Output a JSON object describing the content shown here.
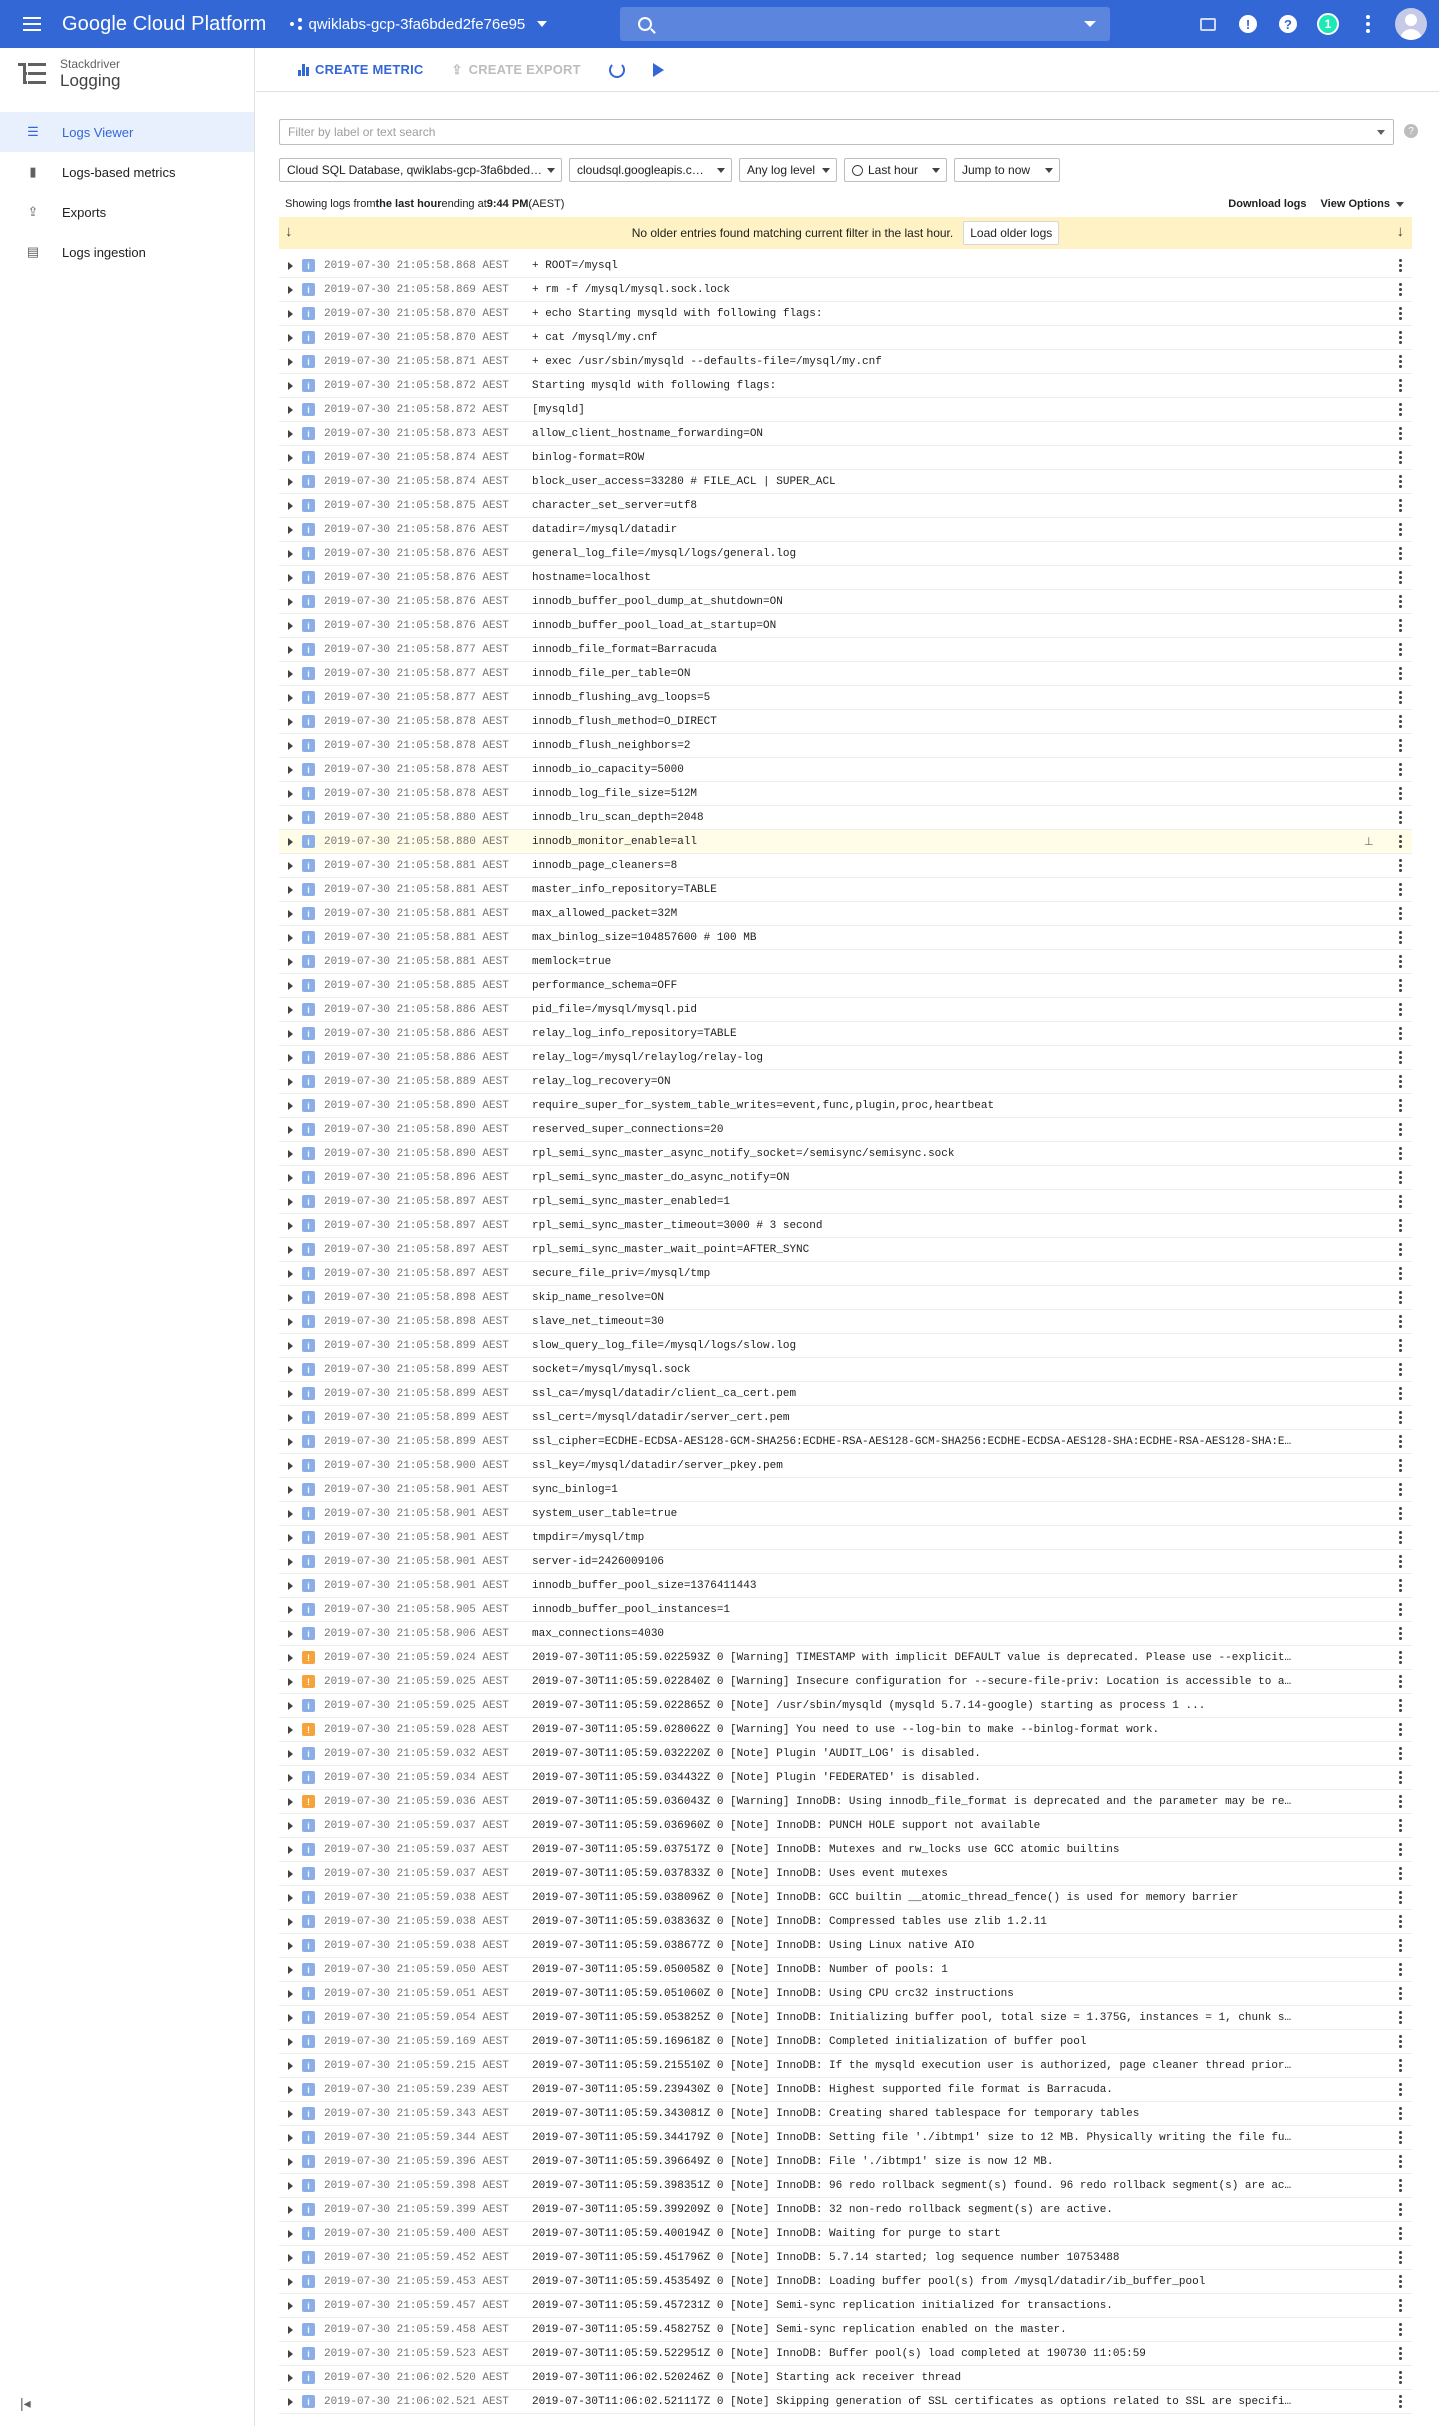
{
  "topbar": {
    "title": "Google Cloud Platform",
    "project": "qwiklabs-gcp-3fa6bded2fe76e95",
    "notification_count": "1"
  },
  "sidebar": {
    "product_sub": "Stackdriver",
    "product_name": "Logging",
    "items": [
      {
        "label": "Logs Viewer",
        "icon": "list-icon",
        "active": true
      },
      {
        "label": "Logs-based metrics",
        "icon": "bar-chart-icon",
        "active": false
      },
      {
        "label": "Exports",
        "icon": "export-icon",
        "active": false
      },
      {
        "label": "Logs ingestion",
        "icon": "ingestion-icon",
        "active": false
      }
    ]
  },
  "toolbar": {
    "create_metric": "CREATE METRIC",
    "create_export": "CREATE EXPORT"
  },
  "filter": {
    "placeholder": "Filter by label or text search"
  },
  "dropdowns": {
    "resource": "Cloud SQL Database, qwiklabs-gcp-3fa6bded…",
    "log": "cloudsql.googleapis.c…",
    "level": "Any log level",
    "time": "Last hour",
    "jump": "Jump to now"
  },
  "info": {
    "prefix": "Showing logs from ",
    "range": "the last hour",
    "middle": " ending at ",
    "end_time": "9:44 PM",
    "tz": " (AEST)",
    "download": "Download logs",
    "view_options": "View Options"
  },
  "notice": {
    "text": "No older entries found matching current filter in the last hour.",
    "button": "Load older logs"
  },
  "colors": {
    "topbar": "#3367d6",
    "info_severity": "#8aaee8",
    "warning_severity": "#f6a33b",
    "notice_bg": "#fff2c4"
  },
  "logs": [
    {
      "s": "i",
      "t": "2019-07-30 21:05:58.868 AEST",
      "m": "+ ROOT=/mysql"
    },
    {
      "s": "i",
      "t": "2019-07-30 21:05:58.869 AEST",
      "m": "+ rm -f /mysql/mysql.sock.lock"
    },
    {
      "s": "i",
      "t": "2019-07-30 21:05:58.870 AEST",
      "m": "+ echo Starting mysqld with following flags:"
    },
    {
      "s": "i",
      "t": "2019-07-30 21:05:58.870 AEST",
      "m": "+ cat /mysql/my.cnf"
    },
    {
      "s": "i",
      "t": "2019-07-30 21:05:58.871 AEST",
      "m": "+ exec /usr/sbin/mysqld --defaults-file=/mysql/my.cnf"
    },
    {
      "s": "i",
      "t": "2019-07-30 21:05:58.872 AEST",
      "m": "Starting mysqld with following flags:"
    },
    {
      "s": "i",
      "t": "2019-07-30 21:05:58.872 AEST",
      "m": "[mysqld]"
    },
    {
      "s": "i",
      "t": "2019-07-30 21:05:58.873 AEST",
      "m": "allow_client_hostname_forwarding=ON"
    },
    {
      "s": "i",
      "t": "2019-07-30 21:05:58.874 AEST",
      "m": "binlog-format=ROW"
    },
    {
      "s": "i",
      "t": "2019-07-30 21:05:58.874 AEST",
      "m": "block_user_access=33280 # FILE_ACL | SUPER_ACL"
    },
    {
      "s": "i",
      "t": "2019-07-30 21:05:58.875 AEST",
      "m": "character_set_server=utf8"
    },
    {
      "s": "i",
      "t": "2019-07-30 21:05:58.876 AEST",
      "m": "datadir=/mysql/datadir"
    },
    {
      "s": "i",
      "t": "2019-07-30 21:05:58.876 AEST",
      "m": "general_log_file=/mysql/logs/general.log"
    },
    {
      "s": "i",
      "t": "2019-07-30 21:05:58.876 AEST",
      "m": "hostname=localhost"
    },
    {
      "s": "i",
      "t": "2019-07-30 21:05:58.876 AEST",
      "m": "innodb_buffer_pool_dump_at_shutdown=ON"
    },
    {
      "s": "i",
      "t": "2019-07-30 21:05:58.876 AEST",
      "m": "innodb_buffer_pool_load_at_startup=ON"
    },
    {
      "s": "i",
      "t": "2019-07-30 21:05:58.877 AEST",
      "m": "innodb_file_format=Barracuda"
    },
    {
      "s": "i",
      "t": "2019-07-30 21:05:58.877 AEST",
      "m": "innodb_file_per_table=ON"
    },
    {
      "s": "i",
      "t": "2019-07-30 21:05:58.877 AEST",
      "m": "innodb_flushing_avg_loops=5"
    },
    {
      "s": "i",
      "t": "2019-07-30 21:05:58.878 AEST",
      "m": "innodb_flush_method=O_DIRECT"
    },
    {
      "s": "i",
      "t": "2019-07-30 21:05:58.878 AEST",
      "m": "innodb_flush_neighbors=2"
    },
    {
      "s": "i",
      "t": "2019-07-30 21:05:58.878 AEST",
      "m": "innodb_io_capacity=5000"
    },
    {
      "s": "i",
      "t": "2019-07-30 21:05:58.878 AEST",
      "m": "innodb_log_file_size=512M"
    },
    {
      "s": "i",
      "t": "2019-07-30 21:05:58.880 AEST",
      "m": "innodb_lru_scan_depth=2048"
    },
    {
      "s": "i",
      "t": "2019-07-30 21:05:58.880 AEST",
      "m": "innodb_monitor_enable=all",
      "hl": true
    },
    {
      "s": "i",
      "t": "2019-07-30 21:05:58.881 AEST",
      "m": "innodb_page_cleaners=8"
    },
    {
      "s": "i",
      "t": "2019-07-30 21:05:58.881 AEST",
      "m": "master_info_repository=TABLE"
    },
    {
      "s": "i",
      "t": "2019-07-30 21:05:58.881 AEST",
      "m": "max_allowed_packet=32M"
    },
    {
      "s": "i",
      "t": "2019-07-30 21:05:58.881 AEST",
      "m": "max_binlog_size=104857600 # 100 MB"
    },
    {
      "s": "i",
      "t": "2019-07-30 21:05:58.881 AEST",
      "m": "memlock=true"
    },
    {
      "s": "i",
      "t": "2019-07-30 21:05:58.885 AEST",
      "m": "performance_schema=OFF"
    },
    {
      "s": "i",
      "t": "2019-07-30 21:05:58.886 AEST",
      "m": "pid_file=/mysql/mysql.pid"
    },
    {
      "s": "i",
      "t": "2019-07-30 21:05:58.886 AEST",
      "m": "relay_log_info_repository=TABLE"
    },
    {
      "s": "i",
      "t": "2019-07-30 21:05:58.886 AEST",
      "m": "relay_log=/mysql/relaylog/relay-log"
    },
    {
      "s": "i",
      "t": "2019-07-30 21:05:58.889 AEST",
      "m": "relay_log_recovery=ON"
    },
    {
      "s": "i",
      "t": "2019-07-30 21:05:58.890 AEST",
      "m": "require_super_for_system_table_writes=event,func,plugin,proc,heartbeat"
    },
    {
      "s": "i",
      "t": "2019-07-30 21:05:58.890 AEST",
      "m": "reserved_super_connections=20"
    },
    {
      "s": "i",
      "t": "2019-07-30 21:05:58.890 AEST",
      "m": "rpl_semi_sync_master_async_notify_socket=/semisync/semisync.sock"
    },
    {
      "s": "i",
      "t": "2019-07-30 21:05:58.896 AEST",
      "m": "rpl_semi_sync_master_do_async_notify=ON"
    },
    {
      "s": "i",
      "t": "2019-07-30 21:05:58.897 AEST",
      "m": "rpl_semi_sync_master_enabled=1"
    },
    {
      "s": "i",
      "t": "2019-07-30 21:05:58.897 AEST",
      "m": "rpl_semi_sync_master_timeout=3000 # 3 second"
    },
    {
      "s": "i",
      "t": "2019-07-30 21:05:58.897 AEST",
      "m": "rpl_semi_sync_master_wait_point=AFTER_SYNC"
    },
    {
      "s": "i",
      "t": "2019-07-30 21:05:58.897 AEST",
      "m": "secure_file_priv=/mysql/tmp"
    },
    {
      "s": "i",
      "t": "2019-07-30 21:05:58.898 AEST",
      "m": "skip_name_resolve=ON"
    },
    {
      "s": "i",
      "t": "2019-07-30 21:05:58.898 AEST",
      "m": "slave_net_timeout=30"
    },
    {
      "s": "i",
      "t": "2019-07-30 21:05:58.899 AEST",
      "m": "slow_query_log_file=/mysql/logs/slow.log"
    },
    {
      "s": "i",
      "t": "2019-07-30 21:05:58.899 AEST",
      "m": "socket=/mysql/mysql.sock"
    },
    {
      "s": "i",
      "t": "2019-07-30 21:05:58.899 AEST",
      "m": "ssl_ca=/mysql/datadir/client_ca_cert.pem"
    },
    {
      "s": "i",
      "t": "2019-07-30 21:05:58.899 AEST",
      "m": "ssl_cert=/mysql/datadir/server_cert.pem"
    },
    {
      "s": "i",
      "t": "2019-07-30 21:05:58.899 AEST",
      "m": "ssl_cipher=ECDHE-ECDSA-AES128-GCM-SHA256:ECDHE-RSA-AES128-GCM-SHA256:ECDHE-ECDSA-AES128-SHA:ECDHE-RSA-AES128-SHA:E…"
    },
    {
      "s": "i",
      "t": "2019-07-30 21:05:58.900 AEST",
      "m": "ssl_key=/mysql/datadir/server_pkey.pem"
    },
    {
      "s": "i",
      "t": "2019-07-30 21:05:58.901 AEST",
      "m": "sync_binlog=1"
    },
    {
      "s": "i",
      "t": "2019-07-30 21:05:58.901 AEST",
      "m": "system_user_table=true"
    },
    {
      "s": "i",
      "t": "2019-07-30 21:05:58.901 AEST",
      "m": "tmpdir=/mysql/tmp"
    },
    {
      "s": "i",
      "t": "2019-07-30 21:05:58.901 AEST",
      "m": "server-id=2426009106"
    },
    {
      "s": "i",
      "t": "2019-07-30 21:05:58.901 AEST",
      "m": "innodb_buffer_pool_size=1376411443"
    },
    {
      "s": "i",
      "t": "2019-07-30 21:05:58.905 AEST",
      "m": "innodb_buffer_pool_instances=1"
    },
    {
      "s": "i",
      "t": "2019-07-30 21:05:58.906 AEST",
      "m": "max_connections=4030"
    },
    {
      "s": "w",
      "t": "2019-07-30 21:05:59.024 AEST",
      "m": "2019-07-30T11:05:59.022593Z 0 [Warning] TIMESTAMP with implicit DEFAULT value is deprecated. Please use --explicit…"
    },
    {
      "s": "w",
      "t": "2019-07-30 21:05:59.025 AEST",
      "m": "2019-07-30T11:05:59.022840Z 0 [Warning] Insecure configuration for --secure-file-priv: Location is accessible to a…"
    },
    {
      "s": "i",
      "t": "2019-07-30 21:05:59.025 AEST",
      "m": "2019-07-30T11:05:59.022865Z 0 [Note] /usr/sbin/mysqld (mysqld 5.7.14-google) starting as process 1 ..."
    },
    {
      "s": "w",
      "t": "2019-07-30 21:05:59.028 AEST",
      "m": "2019-07-30T11:05:59.028062Z 0 [Warning] You need to use --log-bin to make --binlog-format work."
    },
    {
      "s": "i",
      "t": "2019-07-30 21:05:59.032 AEST",
      "m": "2019-07-30T11:05:59.032220Z 0 [Note] Plugin 'AUDIT_LOG' is disabled."
    },
    {
      "s": "i",
      "t": "2019-07-30 21:05:59.034 AEST",
      "m": "2019-07-30T11:05:59.034432Z 0 [Note] Plugin 'FEDERATED' is disabled."
    },
    {
      "s": "w",
      "t": "2019-07-30 21:05:59.036 AEST",
      "m": "2019-07-30T11:05:59.036043Z 0 [Warning] InnoDB: Using innodb_file_format is deprecated and the parameter may be re…"
    },
    {
      "s": "i",
      "t": "2019-07-30 21:05:59.037 AEST",
      "m": "2019-07-30T11:05:59.036960Z 0 [Note] InnoDB: PUNCH HOLE support not available"
    },
    {
      "s": "i",
      "t": "2019-07-30 21:05:59.037 AEST",
      "m": "2019-07-30T11:05:59.037517Z 0 [Note] InnoDB: Mutexes and rw_locks use GCC atomic builtins"
    },
    {
      "s": "i",
      "t": "2019-07-30 21:05:59.037 AEST",
      "m": "2019-07-30T11:05:59.037833Z 0 [Note] InnoDB: Uses event mutexes"
    },
    {
      "s": "i",
      "t": "2019-07-30 21:05:59.038 AEST",
      "m": "2019-07-30T11:05:59.038096Z 0 [Note] InnoDB: GCC builtin __atomic_thread_fence() is used for memory barrier"
    },
    {
      "s": "i",
      "t": "2019-07-30 21:05:59.038 AEST",
      "m": "2019-07-30T11:05:59.038363Z 0 [Note] InnoDB: Compressed tables use zlib 1.2.11"
    },
    {
      "s": "i",
      "t": "2019-07-30 21:05:59.038 AEST",
      "m": "2019-07-30T11:05:59.038677Z 0 [Note] InnoDB: Using Linux native AIO"
    },
    {
      "s": "i",
      "t": "2019-07-30 21:05:59.050 AEST",
      "m": "2019-07-30T11:05:59.050058Z 0 [Note] InnoDB: Number of pools: 1"
    },
    {
      "s": "i",
      "t": "2019-07-30 21:05:59.051 AEST",
      "m": "2019-07-30T11:05:59.051060Z 0 [Note] InnoDB: Using CPU crc32 instructions"
    },
    {
      "s": "i",
      "t": "2019-07-30 21:05:59.054 AEST",
      "m": "2019-07-30T11:05:59.053825Z 0 [Note] InnoDB: Initializing buffer pool, total size = 1.375G, instances = 1, chunk s…"
    },
    {
      "s": "i",
      "t": "2019-07-30 21:05:59.169 AEST",
      "m": "2019-07-30T11:05:59.169618Z 0 [Note] InnoDB: Completed initialization of buffer pool"
    },
    {
      "s": "i",
      "t": "2019-07-30 21:05:59.215 AEST",
      "m": "2019-07-30T11:05:59.215510Z 0 [Note] InnoDB: If the mysqld execution user is authorized, page cleaner thread prior…"
    },
    {
      "s": "i",
      "t": "2019-07-30 21:05:59.239 AEST",
      "m": "2019-07-30T11:05:59.239430Z 0 [Note] InnoDB: Highest supported file format is Barracuda."
    },
    {
      "s": "i",
      "t": "2019-07-30 21:05:59.343 AEST",
      "m": "2019-07-30T11:05:59.343081Z 0 [Note] InnoDB: Creating shared tablespace for temporary tables"
    },
    {
      "s": "i",
      "t": "2019-07-30 21:05:59.344 AEST",
      "m": "2019-07-30T11:05:59.344179Z 0 [Note] InnoDB: Setting file './ibtmp1' size to 12 MB. Physically writing the file fu…"
    },
    {
      "s": "i",
      "t": "2019-07-30 21:05:59.396 AEST",
      "m": "2019-07-30T11:05:59.396649Z 0 [Note] InnoDB: File './ibtmp1' size is now 12 MB."
    },
    {
      "s": "i",
      "t": "2019-07-30 21:05:59.398 AEST",
      "m": "2019-07-30T11:05:59.398351Z 0 [Note] InnoDB: 96 redo rollback segment(s) found. 96 redo rollback segment(s) are ac…"
    },
    {
      "s": "i",
      "t": "2019-07-30 21:05:59.399 AEST",
      "m": "2019-07-30T11:05:59.399209Z 0 [Note] InnoDB: 32 non-redo rollback segment(s) are active."
    },
    {
      "s": "i",
      "t": "2019-07-30 21:05:59.400 AEST",
      "m": "2019-07-30T11:05:59.400194Z 0 [Note] InnoDB: Waiting for purge to start"
    },
    {
      "s": "i",
      "t": "2019-07-30 21:05:59.452 AEST",
      "m": "2019-07-30T11:05:59.451796Z 0 [Note] InnoDB: 5.7.14 started; log sequence number 10753488"
    },
    {
      "s": "i",
      "t": "2019-07-30 21:05:59.453 AEST",
      "m": "2019-07-30T11:05:59.453549Z 0 [Note] InnoDB: Loading buffer pool(s) from /mysql/datadir/ib_buffer_pool"
    },
    {
      "s": "i",
      "t": "2019-07-30 21:05:59.457 AEST",
      "m": "2019-07-30T11:05:59.457231Z 0 [Note] Semi-sync replication initialized for transactions."
    },
    {
      "s": "i",
      "t": "2019-07-30 21:05:59.458 AEST",
      "m": "2019-07-30T11:05:59.458275Z 0 [Note] Semi-sync replication enabled on the master."
    },
    {
      "s": "i",
      "t": "2019-07-30 21:05:59.523 AEST",
      "m": "2019-07-30T11:05:59.522951Z 0 [Note] InnoDB: Buffer pool(s) load completed at 190730 11:05:59"
    },
    {
      "s": "i",
      "t": "2019-07-30 21:06:02.520 AEST",
      "m": "2019-07-30T11:06:02.520246Z 0 [Note] Starting ack receiver thread"
    },
    {
      "s": "i",
      "t": "2019-07-30 21:06:02.521 AEST",
      "m": "2019-07-30T11:06:02.521117Z 0 [Note] Skipping generation of SSL certificates as options related to SSL are specifi…"
    }
  ]
}
